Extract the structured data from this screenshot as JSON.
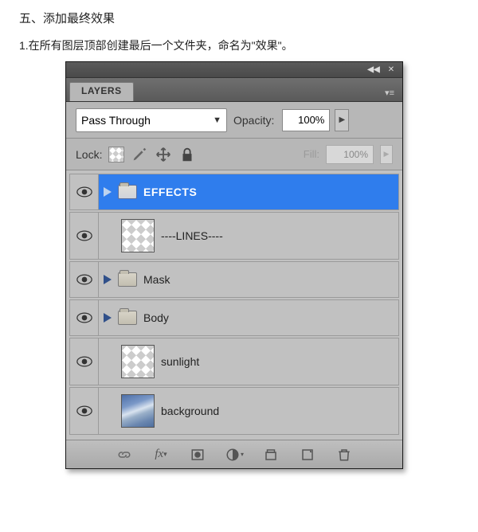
{
  "doc": {
    "heading": "五、添加最终效果",
    "instruction": "1.在所有图层顶部创建最后一个文件夹，命名为\"效果\"。"
  },
  "panel": {
    "tab_label": "LAYERS",
    "blend_mode": "Pass Through",
    "opacity_label": "Opacity:",
    "opacity_value": "100%",
    "lock_label": "Lock:",
    "fill_label": "Fill:",
    "fill_value": "100%",
    "layers": [
      {
        "name": "EFFECTS",
        "type": "folder",
        "selected": true,
        "expanded": false
      },
      {
        "name": "----LINES----",
        "type": "layer",
        "thumb": "checker"
      },
      {
        "name": "Mask",
        "type": "folder",
        "expanded": false
      },
      {
        "name": "Body",
        "type": "folder",
        "expanded": false
      },
      {
        "name": "sunlight",
        "type": "layer",
        "thumb": "checker"
      },
      {
        "name": "background",
        "type": "layer",
        "thumb": "sky"
      }
    ],
    "footer_icons": [
      "link-icon",
      "fx-icon",
      "mask-icon",
      "adjust-icon",
      "group-icon",
      "new-layer-icon",
      "trash-icon"
    ]
  }
}
